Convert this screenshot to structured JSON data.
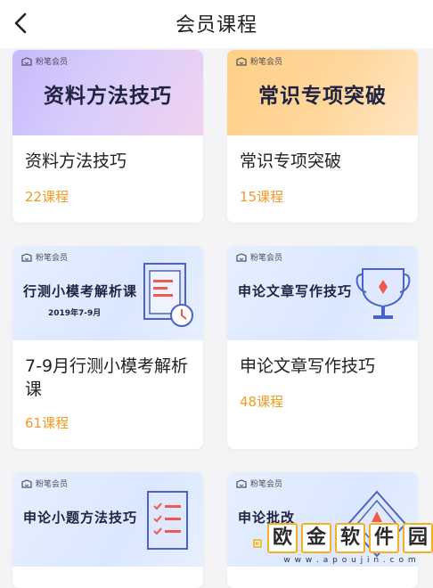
{
  "header": {
    "title": "会员课程",
    "back_icon": "chevron-left-icon"
  },
  "brand_label": "粉笔会员",
  "courses": [
    {
      "banner_text": "资料方法技巧",
      "name": "资料方法技巧",
      "count": "22课程",
      "banner_theme": "purple"
    },
    {
      "banner_text": "常识专项突破",
      "name": "常识专项突破",
      "count": "15课程",
      "banner_theme": "orange"
    },
    {
      "banner_text": "行测小模考解析课",
      "banner_sub": "2019年7-9月",
      "name": "7-9月行测小模考解析课",
      "count": "61课程",
      "banner_theme": "blue",
      "icon": "document-clock-icon"
    },
    {
      "banner_text": "申论文章写作技巧",
      "name": "申论文章写作技巧",
      "count": "48课程",
      "banner_theme": "blue",
      "icon": "trophy-icon"
    },
    {
      "banner_text": "申论小题方法技巧",
      "banner_theme": "blue",
      "icon": "checklist-icon"
    },
    {
      "banner_text": "申论批改",
      "banner_theme": "blue",
      "icon": "badge-icon"
    }
  ],
  "watermark": {
    "chars": [
      "欧",
      "金",
      "软",
      "件",
      "园"
    ],
    "url": "w w w . a p o u j i n . c o m"
  },
  "colors": {
    "accent_orange": "#f19a24",
    "title_text": "#222222",
    "banner_text": "#1f2240",
    "background": "#f4f4f6"
  }
}
